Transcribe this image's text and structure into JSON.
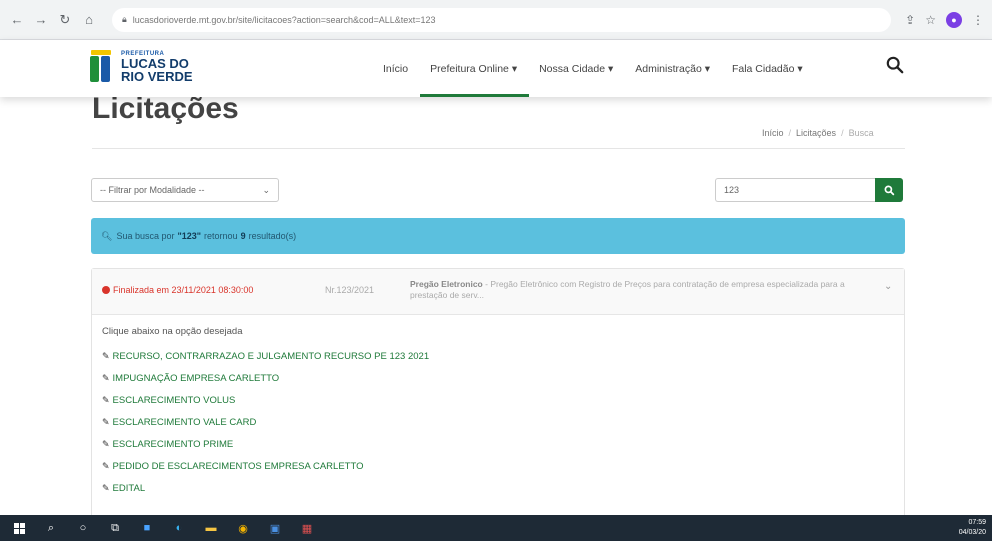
{
  "browser": {
    "url": "lucasdorioverde.mt.gov.br/site/licitacoes?action=search&cod=ALL&text=123"
  },
  "logo": {
    "small": "PREFEITURA",
    "line1": "LUCAS DO",
    "line2": "RIO VERDE"
  },
  "nav": {
    "items": [
      {
        "label": "Início"
      },
      {
        "label": "Prefeitura Online ▾"
      },
      {
        "label": "Nossa Cidade ▾"
      },
      {
        "label": "Administração ▾"
      },
      {
        "label": "Fala Cidadão ▾"
      }
    ]
  },
  "page": {
    "title": "Licitações",
    "breadcrumb": {
      "home": "Início",
      "section": "Licitações",
      "current": "Busca",
      "sep": "/"
    }
  },
  "filters": {
    "modalidade": "-- Filtrar por Modalidade --",
    "search_value": "123"
  },
  "alert": {
    "prefix": "Sua busca por",
    "term": "\"123\"",
    "middle": "retornou",
    "count": "9",
    "suffix": "resultado(s)"
  },
  "result": {
    "status": "Finalizada em 23/11/2021 08:30:00",
    "numero": "Nr.123/2021",
    "modalidade": "Pregão Eletronico",
    "descricao": "- Pregão Eletrônico com Registro de Preços para contratação de empresa especializada para a prestação de serv...",
    "prompt": "Clique abaixo na opção desejada",
    "links": [
      "RECURSO, CONTRARRAZAO E JULGAMENTO RECURSO PE 123 2021",
      "IMPUGNAÇÃO EMPRESA CARLETTO",
      "ESCLARECIMENTO VOLUS",
      "ESCLARECIMENTO VALE CARD",
      "ESCLARECIMENTO PRIME",
      "PEDIDO DE ESCLARECIMENTOS EMPRESA CARLETTO",
      "EDITAL"
    ]
  },
  "taskbar": {
    "time": "07:59",
    "date": "04/03/20"
  },
  "colors": {
    "green": "#1f7a3a",
    "alert": "#5bc0de",
    "red": "#d9342b"
  }
}
